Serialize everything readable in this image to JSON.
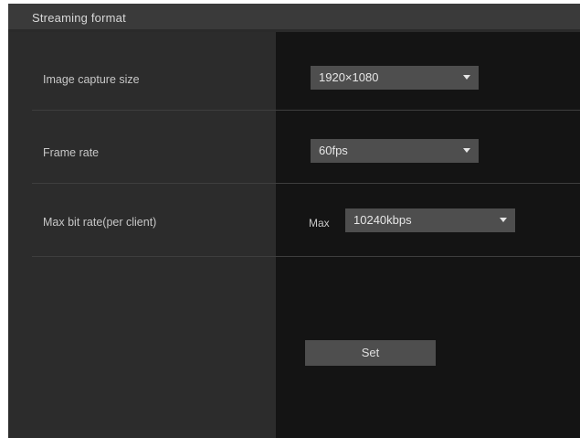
{
  "section": {
    "title": "Streaming format"
  },
  "rows": [
    {
      "label": "Image capture size",
      "value": "1920×1080"
    },
    {
      "label": "Frame rate",
      "value": "60fps"
    },
    {
      "label": "Max bit rate(per client)",
      "prefix": "Max",
      "value": "10240kbps"
    }
  ],
  "set_button": {
    "label": "Set"
  },
  "colors": {
    "header_bg": "#3a3a3a",
    "label_col_bg": "#2c2c2c",
    "value_col_bg": "#141414",
    "select_bg": "#4e4e4e"
  },
  "icons": [
    "chevron-down-icon"
  ]
}
